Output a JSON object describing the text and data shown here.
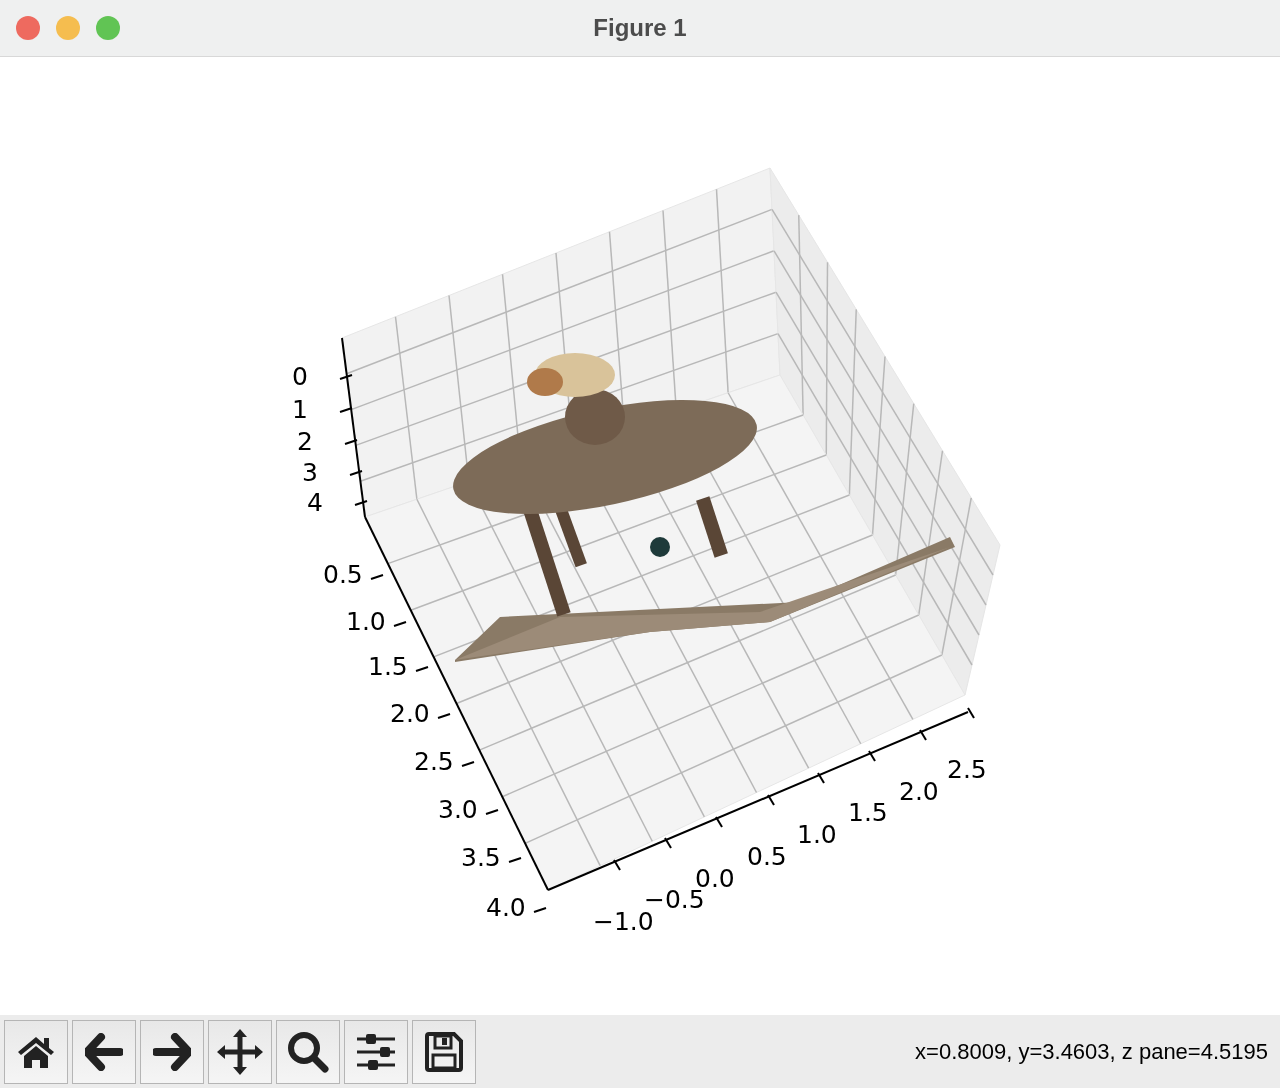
{
  "window": {
    "title": "Figure 1"
  },
  "plot": {
    "z_ticks": [
      "0",
      "1",
      "2",
      "3",
      "4"
    ],
    "y_ticks": [
      "0.5",
      "1.0",
      "1.5",
      "2.0",
      "2.5",
      "3.0",
      "3.5",
      "4.0"
    ],
    "x_ticks": [
      "−1.0",
      "−0.5",
      "0.0",
      "0.5",
      "1.0",
      "1.5",
      "2.0",
      "2.5"
    ]
  },
  "toolbar": [
    {
      "kind": "home"
    },
    {
      "kind": "back"
    },
    {
      "kind": "forward"
    },
    {
      "kind": "pan"
    },
    {
      "kind": "zoom"
    },
    {
      "kind": "configure"
    },
    {
      "kind": "save"
    }
  ],
  "status_bar": {
    "text": "x=0.8009, y=3.4603, z pane=4.5195"
  }
}
